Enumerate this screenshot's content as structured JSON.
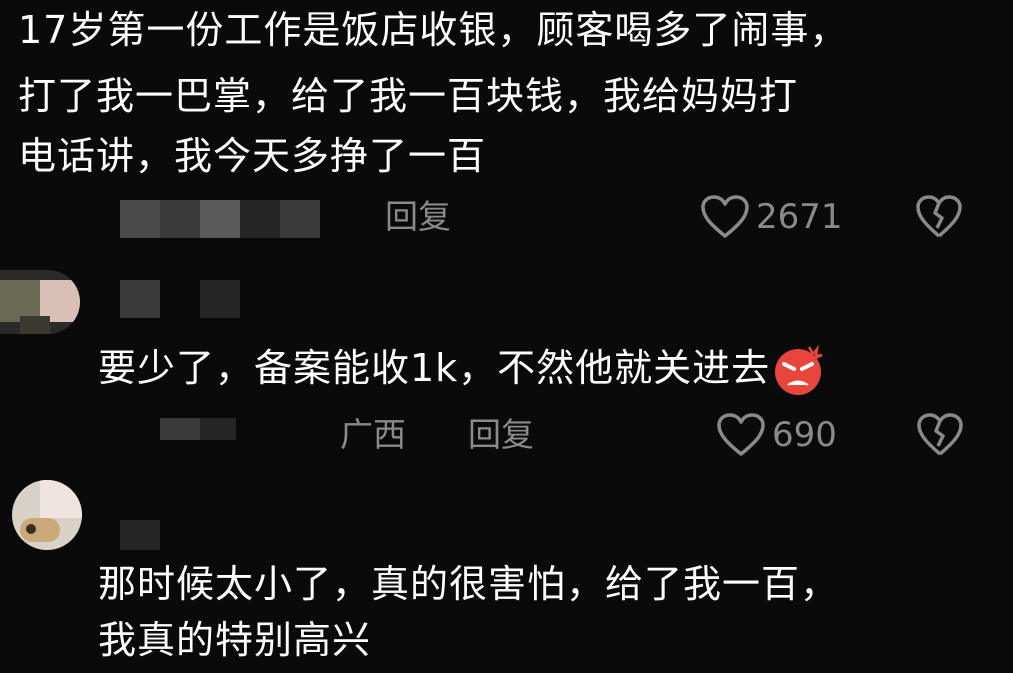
{
  "comments": [
    {
      "text_lines": [
        "17岁第一份工作是饭店收银，顾客喝多了闹事，",
        "打了我一巴掌，给了我一百块钱，我给妈妈打",
        "电话讲，我今天多挣了一百"
      ],
      "reply_label": "回复",
      "like_count": "2671"
    },
    {
      "text": "要少了，备案能收1k，不然他就关进去",
      "emoji": "angry-face",
      "meta_location": "广西",
      "reply_label": "回复",
      "like_count": "690"
    },
    {
      "text_lines": [
        "那时候太小了，真的很害怕，给了我一百，",
        "我真的特别高兴"
      ]
    }
  ],
  "colors": {
    "background": "#0a0a0a",
    "text": "#ffffff",
    "muted": "#8a8a8a",
    "emoji_red": "#e8453c"
  },
  "icons": [
    "heart-outline-icon",
    "broken-heart-icon",
    "angry-face-emoji"
  ]
}
